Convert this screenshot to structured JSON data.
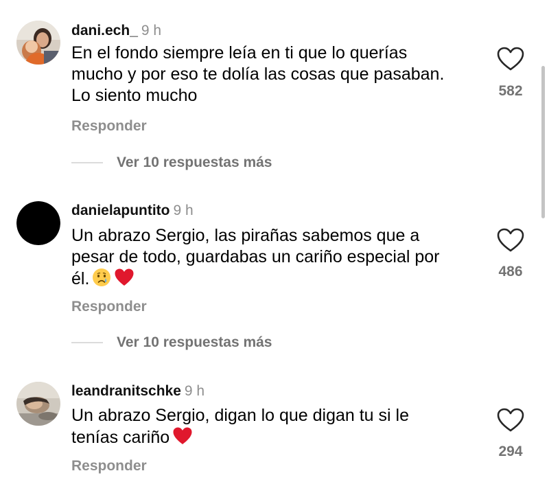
{
  "comments": [
    {
      "username": "dani.ech_",
      "time": "9 h",
      "lines": [
        "En el fondo siempre leía en ti que lo querías",
        "mucho y por eso te dolía las cosas que pasaban.",
        "Lo siento mucho"
      ],
      "likes": "582",
      "reply_label": "Responder",
      "view_replies_label": "Ver 10 respuestas más",
      "avatar_icon": "user-photo-avatar",
      "like_icon": "heart-outline-icon"
    },
    {
      "username": "danielapuntito",
      "time": "9 h",
      "lines": [
        "Un abrazo Sergio, las pirañas sabemos que a",
        "pesar de todo, guardabas un cariño especial por",
        "él."
      ],
      "emojis": [
        "crying-face-emoji",
        "red-heart-emoji"
      ],
      "likes": "486",
      "reply_label": "Responder",
      "view_replies_label": "Ver 10 respuestas más",
      "avatar_icon": "black-circle-avatar",
      "like_icon": "heart-outline-icon"
    },
    {
      "username": "leandranitschke",
      "time": "9 h",
      "lines": [
        "Un abrazo Sergio, digan lo que digan tu si le",
        "tenías cariño"
      ],
      "emojis": [
        "red-heart-emoji"
      ],
      "likes": "294",
      "reply_label": "Responder",
      "avatar_icon": "user-photo-avatar",
      "like_icon": "heart-outline-icon"
    }
  ],
  "colors": {
    "text": "#000000",
    "secondary": "#8e8e8e",
    "count": "#737373",
    "divider": "#dbdbdb",
    "heart": "#e0182d"
  }
}
